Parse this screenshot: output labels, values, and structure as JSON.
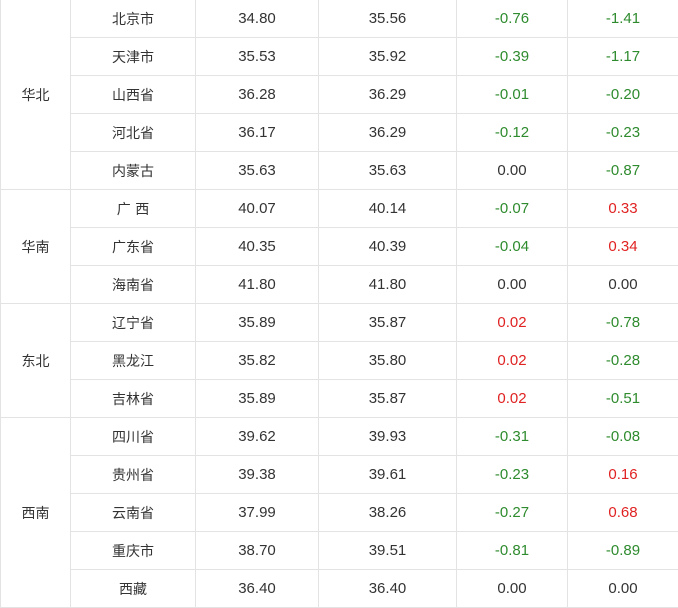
{
  "colors": {
    "positive": "#e02222",
    "negative": "#2e8b2e",
    "neutral": "#333333",
    "border": "#e3e3e3"
  },
  "groups": [
    {
      "region": "华北",
      "rows": [
        {
          "province": "北京市",
          "v1": "34.80",
          "v2": "35.56",
          "d1": "-0.76",
          "d2": "-1.41"
        },
        {
          "province": "天津市",
          "v1": "35.53",
          "v2": "35.92",
          "d1": "-0.39",
          "d2": "-1.17"
        },
        {
          "province": "山西省",
          "v1": "36.28",
          "v2": "36.29",
          "d1": "-0.01",
          "d2": "-0.20"
        },
        {
          "province": "河北省",
          "v1": "36.17",
          "v2": "36.29",
          "d1": "-0.12",
          "d2": "-0.23"
        },
        {
          "province": "内蒙古",
          "v1": "35.63",
          "v2": "35.63",
          "d1": "0.00",
          "d2": "-0.87"
        }
      ]
    },
    {
      "region": "华南",
      "rows": [
        {
          "province": "广 西",
          "v1": "40.07",
          "v2": "40.14",
          "d1": "-0.07",
          "d2": "0.33"
        },
        {
          "province": "广东省",
          "v1": "40.35",
          "v2": "40.39",
          "d1": "-0.04",
          "d2": "0.34"
        },
        {
          "province": "海南省",
          "v1": "41.80",
          "v2": "41.80",
          "d1": "0.00",
          "d2": "0.00"
        }
      ]
    },
    {
      "region": "东北",
      "rows": [
        {
          "province": "辽宁省",
          "v1": "35.89",
          "v2": "35.87",
          "d1": "0.02",
          "d2": "-0.78"
        },
        {
          "province": "黑龙江",
          "v1": "35.82",
          "v2": "35.80",
          "d1": "0.02",
          "d2": "-0.28"
        },
        {
          "province": "吉林省",
          "v1": "35.89",
          "v2": "35.87",
          "d1": "0.02",
          "d2": "-0.51"
        }
      ]
    },
    {
      "region": "西南",
      "rows": [
        {
          "province": "四川省",
          "v1": "39.62",
          "v2": "39.93",
          "d1": "-0.31",
          "d2": "-0.08"
        },
        {
          "province": "贵州省",
          "v1": "39.38",
          "v2": "39.61",
          "d1": "-0.23",
          "d2": "0.16"
        },
        {
          "province": "云南省",
          "v1": "37.99",
          "v2": "38.26",
          "d1": "-0.27",
          "d2": "0.68"
        },
        {
          "province": "重庆市",
          "v1": "38.70",
          "v2": "39.51",
          "d1": "-0.81",
          "d2": "-0.89"
        },
        {
          "province": "西藏",
          "v1": "36.40",
          "v2": "36.40",
          "d1": "0.00",
          "d2": "0.00"
        }
      ]
    }
  ]
}
